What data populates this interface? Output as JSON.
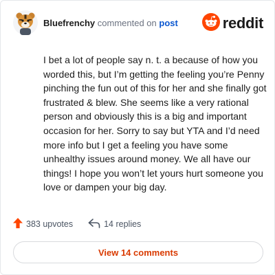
{
  "comment": {
    "author": "Bluefrenchy",
    "action_text": "commented on",
    "post_link": "post",
    "body": "I bet a lot of people say n. t. a because of how you worded this, but I’m getting the feeling you’re Penny pinching the fun out of this for her and she finally got frustrated & blew. She seems like a very rational person and obviously this is a big and important occasion for her. Sorry to say but YTA and I’d need more info but I get a feeling you have some unhealthy issues around money. We all have our things! I hope you won’t let yours hurt someone you love or dampen your big day."
  },
  "brand": {
    "name": "reddit",
    "icon": "reddit-logo-icon",
    "color": "#ff4500"
  },
  "stats": {
    "upvotes": "383 upvotes",
    "replies": "14 replies"
  },
  "footer": {
    "view_comments_label": "View 14 comments"
  },
  "colors": {
    "accent": "#d93a00",
    "upvote": "#ff4500",
    "link": "#0b57d0"
  }
}
